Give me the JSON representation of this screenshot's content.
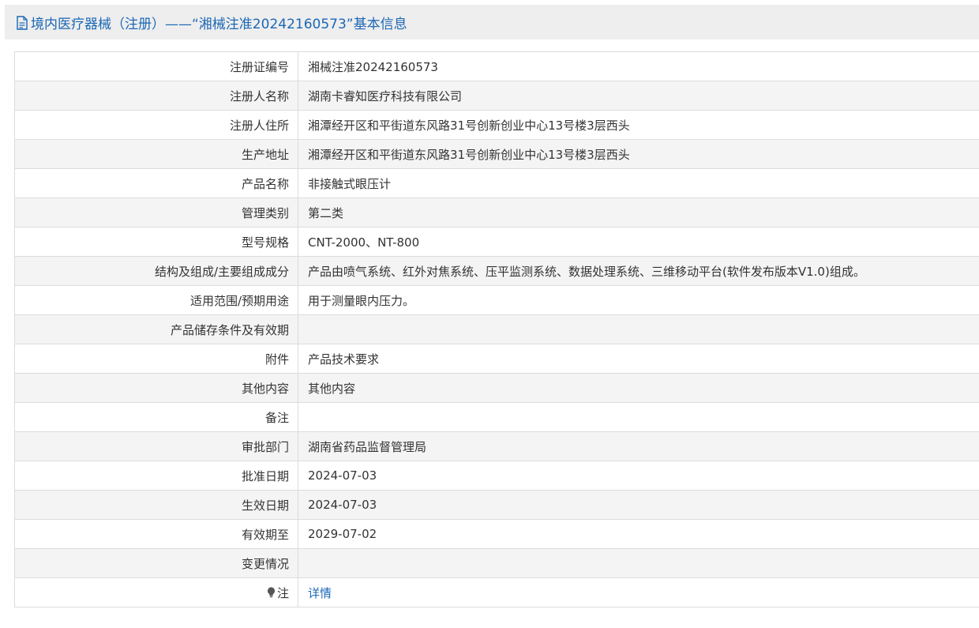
{
  "header": {
    "title": "境内医疗器械（注册）——“湘械注准20242160573”基本信息"
  },
  "rows": [
    {
      "label": "注册证编号",
      "value": "湘械注准20242160573"
    },
    {
      "label": "注册人名称",
      "value": "湖南卡睿知医疗科技有限公司"
    },
    {
      "label": "注册人住所",
      "value": "湘潭经开区和平街道东风路31号创新创业中心13号楼3层西头"
    },
    {
      "label": "生产地址",
      "value": "湘潭经开区和平街道东风路31号创新创业中心13号楼3层西头"
    },
    {
      "label": "产品名称",
      "value": "非接触式眼压计"
    },
    {
      "label": "管理类别",
      "value": "第二类"
    },
    {
      "label": "型号规格",
      "value": "CNT-2000、NT-800"
    },
    {
      "label": "结构及组成/主要组成成分",
      "value": "产品由喷气系统、红外对焦系统、压平监测系统、数据处理系统、三维移动平台(软件发布版本V1.0)组成。"
    },
    {
      "label": "适用范围/预期用途",
      "value": "用于测量眼内压力。"
    },
    {
      "label": "产品储存条件及有效期",
      "value": ""
    },
    {
      "label": "附件",
      "value": "产品技术要求"
    },
    {
      "label": "其他内容",
      "value": "其他内容"
    },
    {
      "label": "备注",
      "value": ""
    },
    {
      "label": "审批部门",
      "value": "湖南省药品监督管理局"
    },
    {
      "label": "批准日期",
      "value": "2024-07-03"
    },
    {
      "label": "生效日期",
      "value": "2024-07-03"
    },
    {
      "label": "有效期至",
      "value": "2029-07-02"
    },
    {
      "label": "变更情况",
      "value": ""
    }
  ],
  "note_row": {
    "label": "注",
    "link_text": "详情",
    "icon": "lightbulb-icon"
  },
  "colors": {
    "title_text": "#1b67b5",
    "link": "#1b67b5",
    "title_bar_bg": "#eeeeee",
    "alt_row_bg": "#f4f4f4",
    "border": "#dcdcdc"
  }
}
